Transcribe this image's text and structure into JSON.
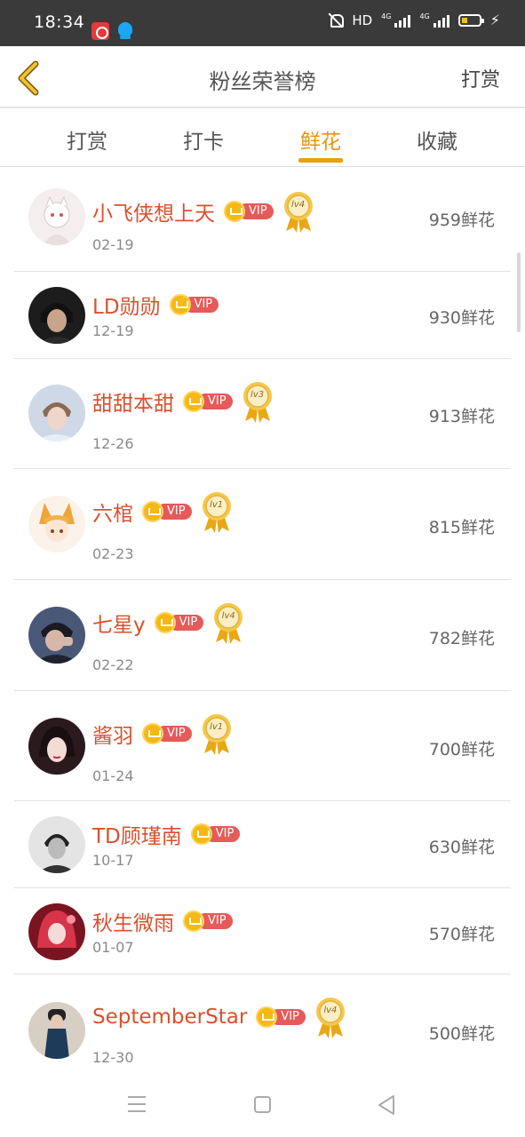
{
  "status_bar": {
    "time": "18:34",
    "hd": "HD",
    "network_1": "4G",
    "network_2": "4G"
  },
  "header": {
    "title": "粉丝荣誉榜",
    "right_action": "打赏"
  },
  "tabs": [
    {
      "label": "打赏",
      "active": false
    },
    {
      "label": "打卡",
      "active": false
    },
    {
      "label": "鲜花",
      "active": true
    },
    {
      "label": "收藏",
      "active": false
    }
  ],
  "vip_label": "VIP",
  "fans": [
    {
      "name": "小飞侠想上天",
      "date": "02-19",
      "count": "959鲜花",
      "level": "lv4"
    },
    {
      "name": "LD勋勋",
      "date": "12-19",
      "count": "930鲜花",
      "level": ""
    },
    {
      "name": "甜甜本甜",
      "date": "12-26",
      "count": "913鲜花",
      "level": "lv3"
    },
    {
      "name": "六棺",
      "date": "02-23",
      "count": "815鲜花",
      "level": "lv1"
    },
    {
      "name": "七星y",
      "date": "02-22",
      "count": "782鲜花",
      "level": "lv4"
    },
    {
      "name": "酱羽",
      "date": "01-24",
      "count": "700鲜花",
      "level": "lv1"
    },
    {
      "name": "TD顾瑾南",
      "date": "10-17",
      "count": "630鲜花",
      "level": ""
    },
    {
      "name": "秋生微雨",
      "date": "01-07",
      "count": "570鲜花",
      "level": ""
    },
    {
      "name": "SeptemberStar",
      "date": "12-30",
      "count": "500鲜花",
      "level": "lv4"
    }
  ],
  "colors": {
    "accent": "#e8940c",
    "name": "#d9502e",
    "vip": "#e65a5a"
  }
}
